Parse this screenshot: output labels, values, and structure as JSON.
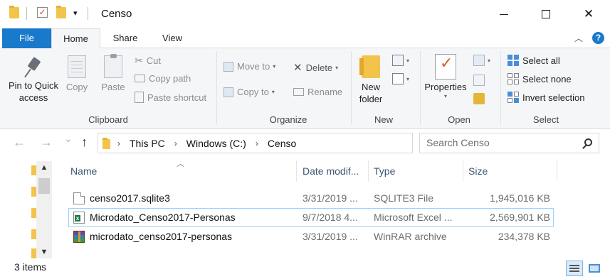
{
  "window": {
    "title": "Censo",
    "qa_dropdown": "▾",
    "minimize_icon": "minimize-icon",
    "close_glyph": "✕"
  },
  "ribbon_tabs": {
    "file": "File",
    "home": "Home",
    "share": "Share",
    "view": "View",
    "collapse_glyph": "︿",
    "help_glyph": "?"
  },
  "clipboard": {
    "pin_to_quick_access": "Pin to Quick access",
    "copy": "Copy",
    "paste": "Paste",
    "cut": "Cut",
    "copy_path": "Copy path",
    "paste_shortcut": "Paste shortcut",
    "group_label": "Clipboard"
  },
  "organize": {
    "move_to": "Move to",
    "copy_to": "Copy to",
    "delete": "Delete",
    "rename": "Rename",
    "group_label": "Organize"
  },
  "new_group": {
    "new_folder": "New folder",
    "group_label": "New"
  },
  "open_group": {
    "properties": "Properties",
    "group_label": "Open"
  },
  "select_group": {
    "select_all": "Select all",
    "select_none": "Select none",
    "invert_selection": "Invert selection",
    "group_label": "Select"
  },
  "navigation": {
    "back_glyph": "←",
    "forward_glyph": "→",
    "recent_glyph": "⌄",
    "up_glyph": "↑",
    "breadcrumb": [
      "This PC",
      "Windows (C:)",
      "Censo"
    ],
    "breadcrumb_sep": "›",
    "refresh_glyph": "↻",
    "search_placeholder": "Search Censo"
  },
  "file_list": {
    "columns": {
      "name": "Name",
      "date": "Date modif...",
      "type": "Type",
      "size": "Size"
    },
    "rows": [
      {
        "name": "censo2017.sqlite3",
        "date": "3/31/2019 ...",
        "type": "SQLITE3 File",
        "size": "1,945,016 KB",
        "icon": "sqlite-file-icon"
      },
      {
        "name": "Microdato_Censo2017-Personas",
        "date": "9/7/2018 4...",
        "type": "Microsoft Excel ...",
        "size": "2,569,901 KB",
        "icon": "excel-file-icon"
      },
      {
        "name": "microdato_censo2017-personas",
        "date": "3/31/2019 ...",
        "type": "WinRAR archive",
        "size": "234,378 KB",
        "icon": "winrar-archive-icon"
      }
    ]
  },
  "status_bar": {
    "item_count": "3 items"
  },
  "colors": {
    "accent": "#1979ca",
    "ribbon_bg": "#f5f6f7",
    "selection_border": "#99d1ff",
    "header_text": "#3b5574"
  }
}
